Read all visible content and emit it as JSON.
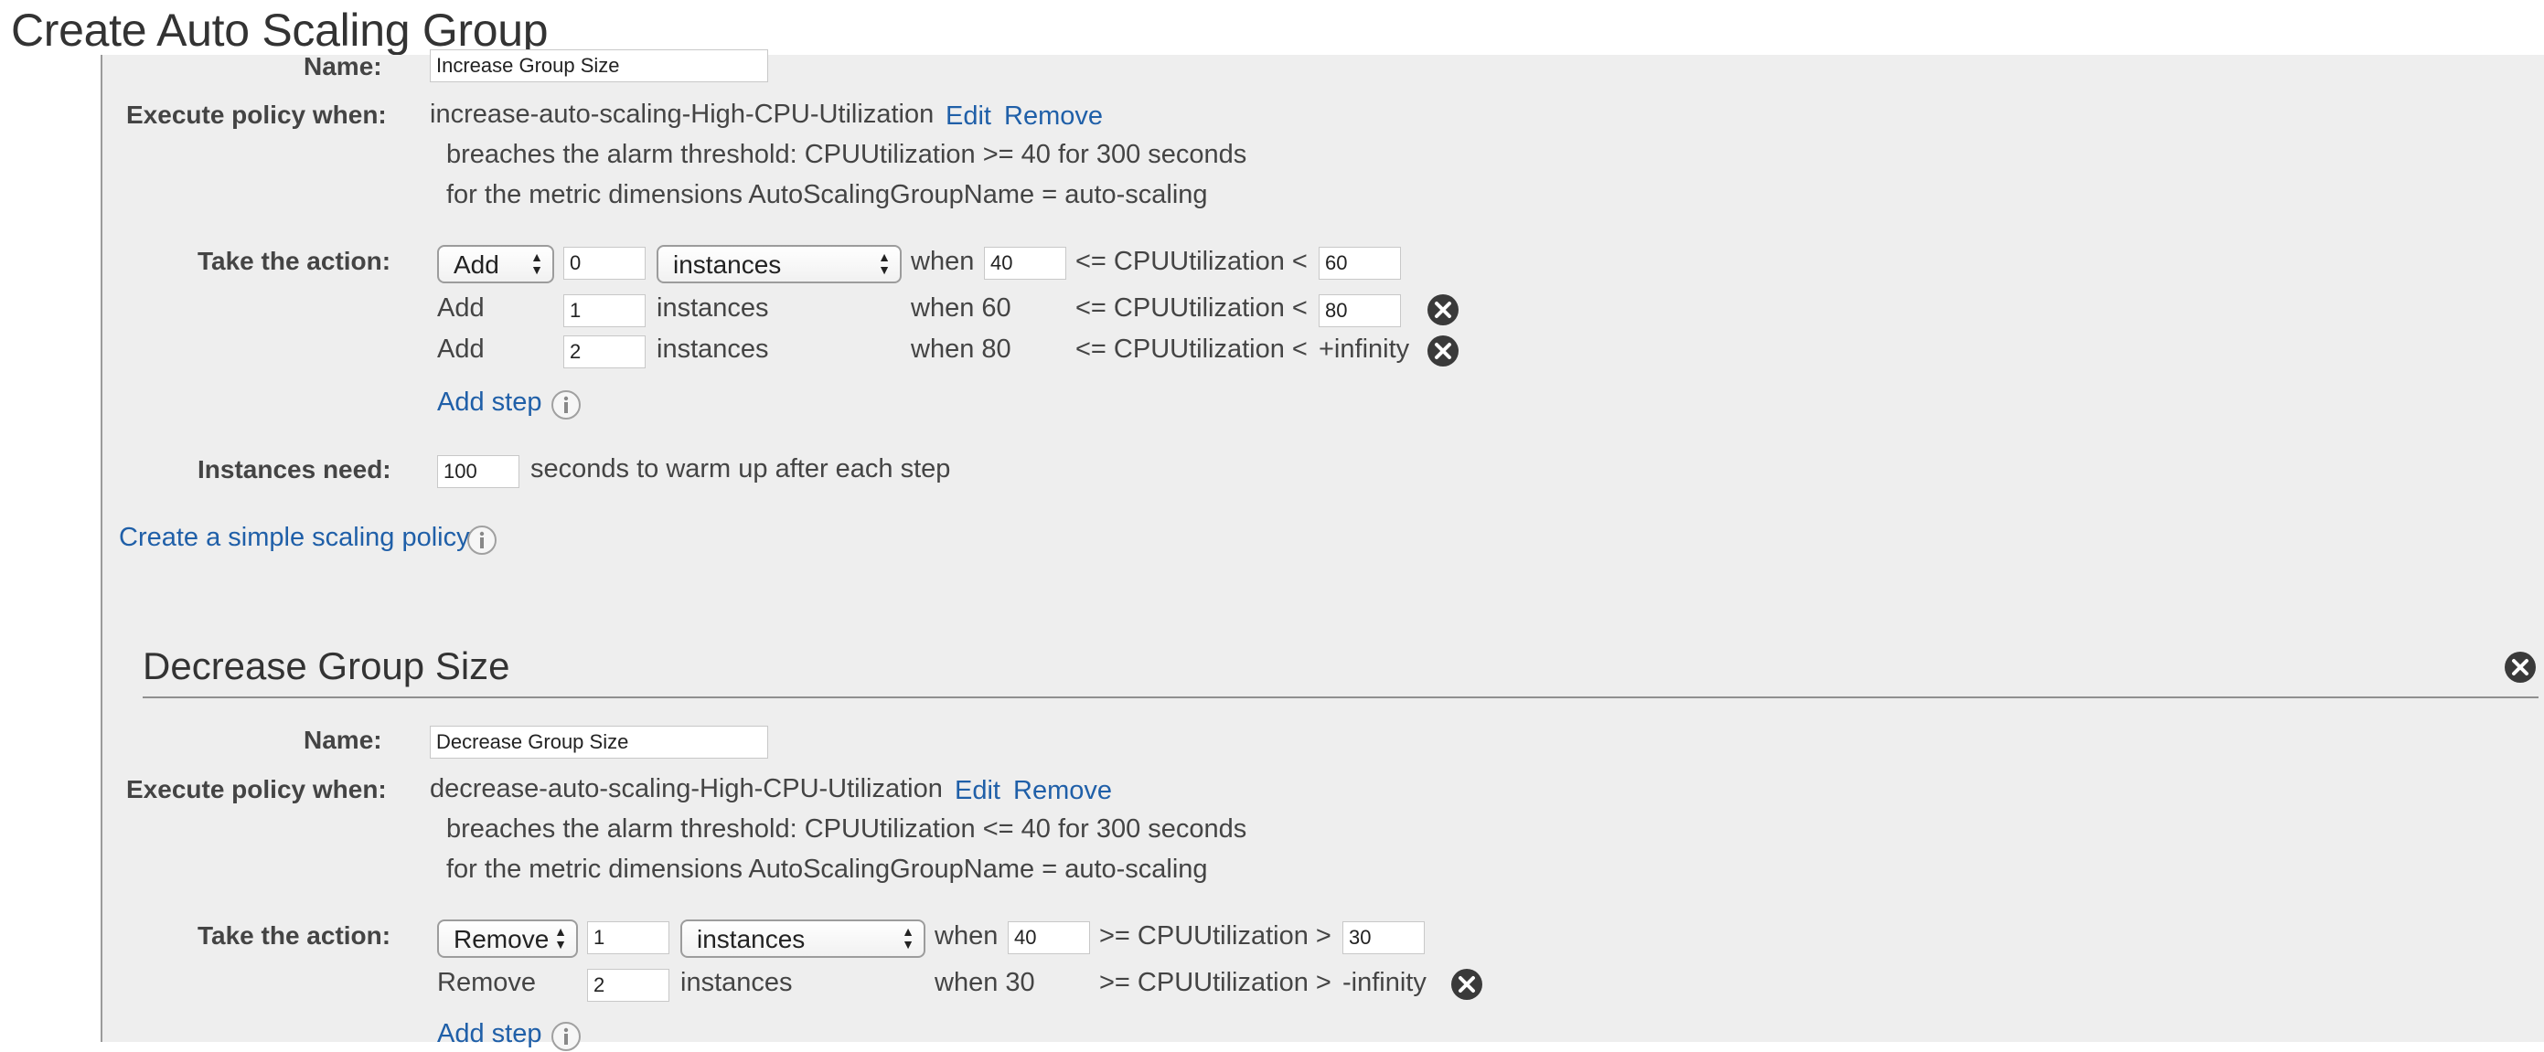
{
  "page": {
    "title": "Create Auto Scaling Group"
  },
  "increase": {
    "name_label": "Name:",
    "name_value": "Increase Group Size",
    "execute_label": "Execute policy when:",
    "alarm_name": "increase-auto-scaling-High-CPU-Utilization",
    "edit_label": "Edit",
    "remove_label": "Remove",
    "breach_text": "breaches the alarm threshold: CPUUtilization >= 40 for 300 seconds",
    "dimensions_text": "for the metric dimensions AutoScalingGroupName = auto-scaling",
    "action_label": "Take the action:",
    "step1": {
      "action": "Add",
      "count": "0",
      "unit": "instances",
      "when": "when",
      "lower": "40",
      "op": "<= CPUUtilization <",
      "upper": "60"
    },
    "step2": {
      "action": "Add",
      "count": "1",
      "unit": "instances",
      "when": "when 60",
      "op": "<= CPUUtilization <",
      "upper": "80"
    },
    "step3": {
      "action": "Add",
      "count": "2",
      "unit": "instances",
      "when": "when 80",
      "op": "<= CPUUtilization <",
      "upper": "+infinity"
    },
    "add_step_label": "Add step",
    "warmup_label": "Instances need:",
    "warmup_value": "100",
    "warmup_text": "seconds to warm up after each step",
    "simple_policy_link": "Create a simple scaling policy"
  },
  "decrease": {
    "title": "Decrease Group Size",
    "name_label": "Name:",
    "name_value": "Decrease Group Size",
    "execute_label": "Execute policy when:",
    "alarm_name": "decrease-auto-scaling-High-CPU-Utilization",
    "edit_label": "Edit",
    "remove_label": "Remove",
    "breach_text": "breaches the alarm threshold: CPUUtilization <= 40 for 300 seconds",
    "dimensions_text": "for the metric dimensions AutoScalingGroupName = auto-scaling",
    "action_label": "Take the action:",
    "step1": {
      "action": "Remove",
      "count": "1",
      "unit": "instances",
      "when": "when",
      "lower": "40",
      "op": ">= CPUUtilization >",
      "upper": "30"
    },
    "step2": {
      "action": "Remove",
      "count": "2",
      "unit": "instances",
      "when": "when 30",
      "op": ">= CPUUtilization >",
      "upper": "-infinity"
    },
    "add_step_label": "Add step"
  },
  "icons": {
    "remove_step": "close-circle-icon",
    "info": "info-icon",
    "select_arrows": "up-down-arrows-icon"
  },
  "colors": {
    "link": "#1f5fa8",
    "panel": "#eeeeee",
    "text": "#444444"
  }
}
